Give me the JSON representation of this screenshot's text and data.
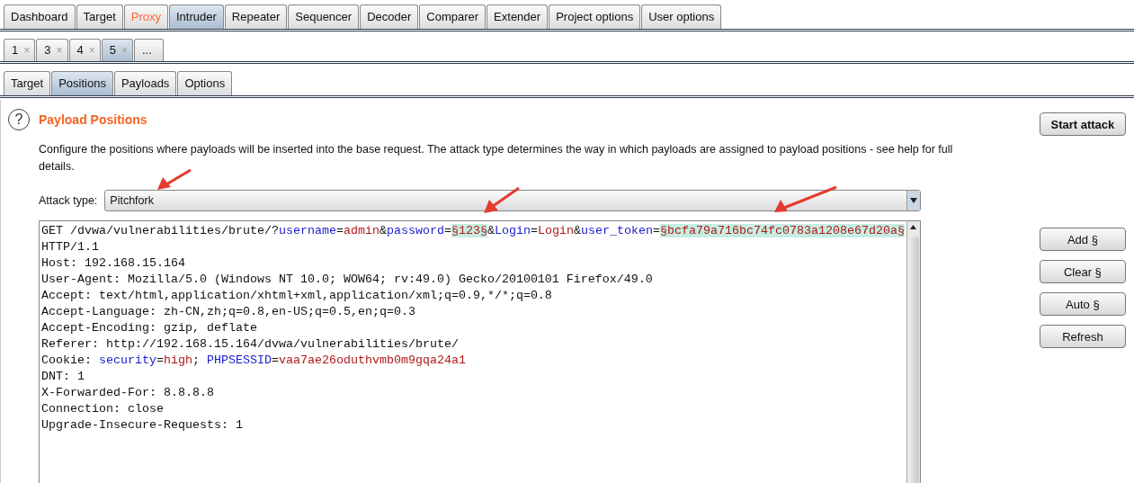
{
  "main_tabs": [
    {
      "label": "Dashboard",
      "selected": false,
      "alert": false
    },
    {
      "label": "Target",
      "selected": false,
      "alert": false
    },
    {
      "label": "Proxy",
      "selected": false,
      "alert": true
    },
    {
      "label": "Intruder",
      "selected": true,
      "alert": false
    },
    {
      "label": "Repeater",
      "selected": false,
      "alert": false
    },
    {
      "label": "Sequencer",
      "selected": false,
      "alert": false
    },
    {
      "label": "Decoder",
      "selected": false,
      "alert": false
    },
    {
      "label": "Comparer",
      "selected": false,
      "alert": false
    },
    {
      "label": "Extender",
      "selected": false,
      "alert": false
    },
    {
      "label": "Project options",
      "selected": false,
      "alert": false
    },
    {
      "label": "User options",
      "selected": false,
      "alert": false
    }
  ],
  "attack_tabs": [
    {
      "label": "1",
      "close": "×",
      "selected": false
    },
    {
      "label": "3",
      "close": "×",
      "selected": false
    },
    {
      "label": "4",
      "close": "×",
      "selected": false
    },
    {
      "label": "5",
      "close": "×",
      "selected": true
    },
    {
      "label": "...",
      "selected": false
    }
  ],
  "sub_tabs": [
    {
      "label": "Target",
      "selected": false
    },
    {
      "label": "Positions",
      "selected": true
    },
    {
      "label": "Payloads",
      "selected": false
    },
    {
      "label": "Options",
      "selected": false
    }
  ],
  "section": {
    "title": "Payload Positions",
    "help_icon": "?",
    "description": "Configure the positions where payloads will be inserted into the base request. The attack type determines the way in which payloads are assigned to payload positions - see help for full details."
  },
  "attack_type": {
    "label": "Attack type:",
    "value": "Pitchfork"
  },
  "request_lines": [
    [
      {
        "text": "GET /dvwa/vulnerabilities/brute/?",
        "kind": "plain"
      },
      {
        "text": "username",
        "kind": "name"
      },
      {
        "text": "=",
        "kind": "plain"
      },
      {
        "text": "admin",
        "kind": "value"
      },
      {
        "text": "&",
        "kind": "plain"
      },
      {
        "text": "password",
        "kind": "name"
      },
      {
        "text": "=",
        "kind": "plain"
      },
      {
        "text": "§123§",
        "kind": "marker"
      },
      {
        "text": "&",
        "kind": "plain"
      },
      {
        "text": "Login",
        "kind": "name"
      },
      {
        "text": "=",
        "kind": "plain"
      },
      {
        "text": "Login",
        "kind": "value"
      },
      {
        "text": "&",
        "kind": "plain"
      },
      {
        "text": "user_token",
        "kind": "name"
      },
      {
        "text": "=",
        "kind": "plain"
      },
      {
        "text": "§bcfa79a716bc74fc0783a1208e67d20a§",
        "kind": "marker"
      }
    ],
    [
      {
        "text": "HTTP/1.1",
        "kind": "plain"
      }
    ],
    [
      {
        "text": "Host: 192.168.15.164",
        "kind": "plain"
      }
    ],
    [
      {
        "text": "User-Agent: Mozilla/5.0 (Windows NT 10.0; WOW64; rv:49.0) Gecko/20100101 Firefox/49.0",
        "kind": "plain"
      }
    ],
    [
      {
        "text": "Accept: text/html,application/xhtml+xml,application/xml;q=0.9,*/*;q=0.8",
        "kind": "plain"
      }
    ],
    [
      {
        "text": "Accept-Language: zh-CN,zh;q=0.8,en-US;q=0.5,en;q=0.3",
        "kind": "plain"
      }
    ],
    [
      {
        "text": "Accept-Encoding: gzip, deflate",
        "kind": "plain"
      }
    ],
    [
      {
        "text": "Referer: http://192.168.15.164/dvwa/vulnerabilities/brute/",
        "kind": "plain"
      }
    ],
    [
      {
        "text": "Cookie: ",
        "kind": "plain"
      },
      {
        "text": "security",
        "kind": "name"
      },
      {
        "text": "=",
        "kind": "plain"
      },
      {
        "text": "high",
        "kind": "value"
      },
      {
        "text": "; ",
        "kind": "plain"
      },
      {
        "text": "PHPSESSID",
        "kind": "name"
      },
      {
        "text": "=",
        "kind": "plain"
      },
      {
        "text": "vaa7ae26oduthvmb0m9gqa24a1",
        "kind": "value"
      }
    ],
    [
      {
        "text": "DNT: 1",
        "kind": "plain"
      }
    ],
    [
      {
        "text": "X-Forwarded-For: 8.8.8.8",
        "kind": "plain"
      }
    ],
    [
      {
        "text": "Connection: close",
        "kind": "plain"
      }
    ],
    [
      {
        "text": "Upgrade-Insecure-Requests: 1",
        "kind": "plain"
      }
    ]
  ],
  "start_button": "Start attack",
  "side_buttons": [
    "Add §",
    "Clear §",
    "Auto §",
    "Refresh"
  ]
}
